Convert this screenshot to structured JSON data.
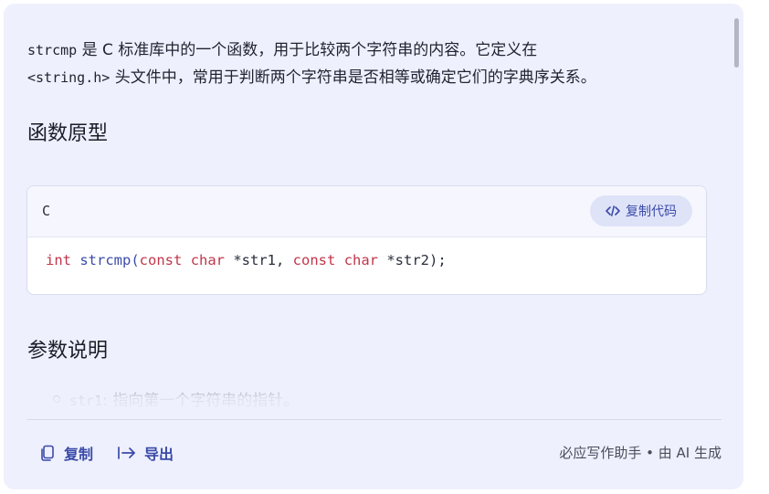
{
  "intro": {
    "code_fn": "strcmp",
    "text1": " 是 C 标准库中的一个函数，用于比较两个字符串的内容。它定义在",
    "header_file": "<string.h>",
    "text2": " 头文件中，常用于判断两个字符串是否相等或确定它们的字典序关系。"
  },
  "sections": {
    "prototype_heading": "函数原型",
    "params_heading": "参数说明"
  },
  "code_block": {
    "language": "C",
    "copy_label": "复制代码",
    "tokens": {
      "t_int": "int",
      "t_fn": " strcmp",
      "t_paren": "(",
      "t_const1": "const",
      "t_sp1": " ",
      "t_char1": "char",
      "t_arg1": " *str1, ",
      "t_const2": "const",
      "t_sp2": " ",
      "t_char2": "char",
      "t_arg2": " *str2);"
    }
  },
  "params": [
    {
      "name": "str1",
      "desc": ": 指向第一个字符串的指针。"
    }
  ],
  "footer": {
    "copy_label": "复制",
    "export_label": "导出",
    "note": "必应写作助手 • 由 AI 生成"
  },
  "icons": {
    "code": "code-icon",
    "copy": "copy-icon",
    "export": "export-icon"
  },
  "colors": {
    "panel_bg": "#eef0fd",
    "accent": "#3a4aa8",
    "keyword": "#c0364a"
  }
}
